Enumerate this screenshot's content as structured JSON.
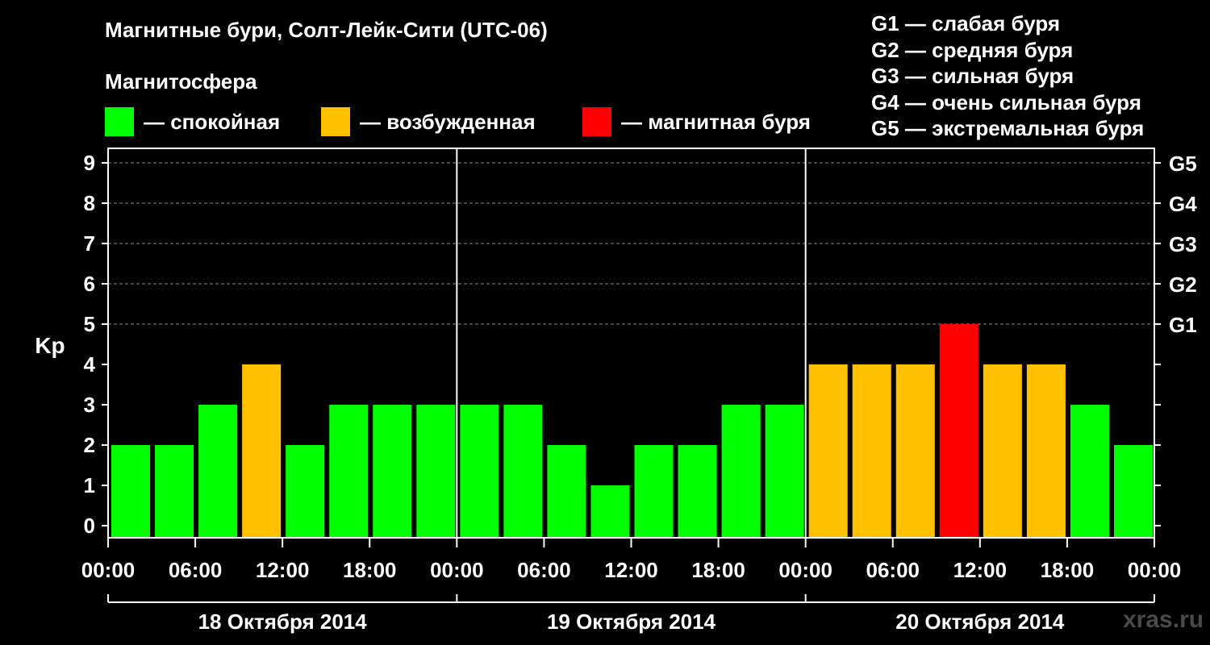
{
  "title": "Магнитные бури, Солт-Лейк-Сити (UTC-06)",
  "magnetosphere_label": "Магнитосфера",
  "legend": [
    {
      "text": "— спокойная",
      "color": "#00ff00"
    },
    {
      "text": "— возбужденная",
      "color": "#ffc000"
    },
    {
      "text": "— магнитная буря",
      "color": "#ff0000"
    }
  ],
  "g_scale": [
    "G1 — слабая буря",
    "G2 — средняя буря",
    "G3 — сильная буря",
    "G4 — очень сильная буря",
    "G5 — экстремальная буря"
  ],
  "watermark": "xras.ru",
  "chart_data": {
    "type": "bar",
    "ylabel": "Kp",
    "ylim": [
      0,
      9
    ],
    "y_ticks": [
      "0",
      "1",
      "2",
      "3",
      "4",
      "5",
      "6",
      "7",
      "8",
      "9"
    ],
    "right_ticks": [
      {
        "value": 5,
        "label": "G1"
      },
      {
        "value": 6,
        "label": "G2"
      },
      {
        "value": 7,
        "label": "G3"
      },
      {
        "value": 8,
        "label": "G4"
      },
      {
        "value": 9,
        "label": "G5"
      }
    ],
    "x_tick_labels": [
      "00:00",
      "06:00",
      "12:00",
      "18:00",
      "00:00",
      "06:00",
      "12:00",
      "18:00",
      "00:00",
      "06:00",
      "12:00",
      "18:00",
      "00:00"
    ],
    "days": [
      "18 Октября 2014",
      "19 Октября 2014",
      "20 Октября 2014"
    ],
    "values": [
      2,
      2,
      3,
      4,
      2,
      3,
      3,
      3,
      3,
      3,
      2,
      1,
      2,
      2,
      3,
      3,
      4,
      4,
      4,
      5,
      4,
      4,
      3,
      2
    ],
    "colors": {
      "quiet": "#00ff00",
      "active": "#ffc000",
      "storm": "#ff0000"
    },
    "grid": "dashed at 5–9"
  }
}
